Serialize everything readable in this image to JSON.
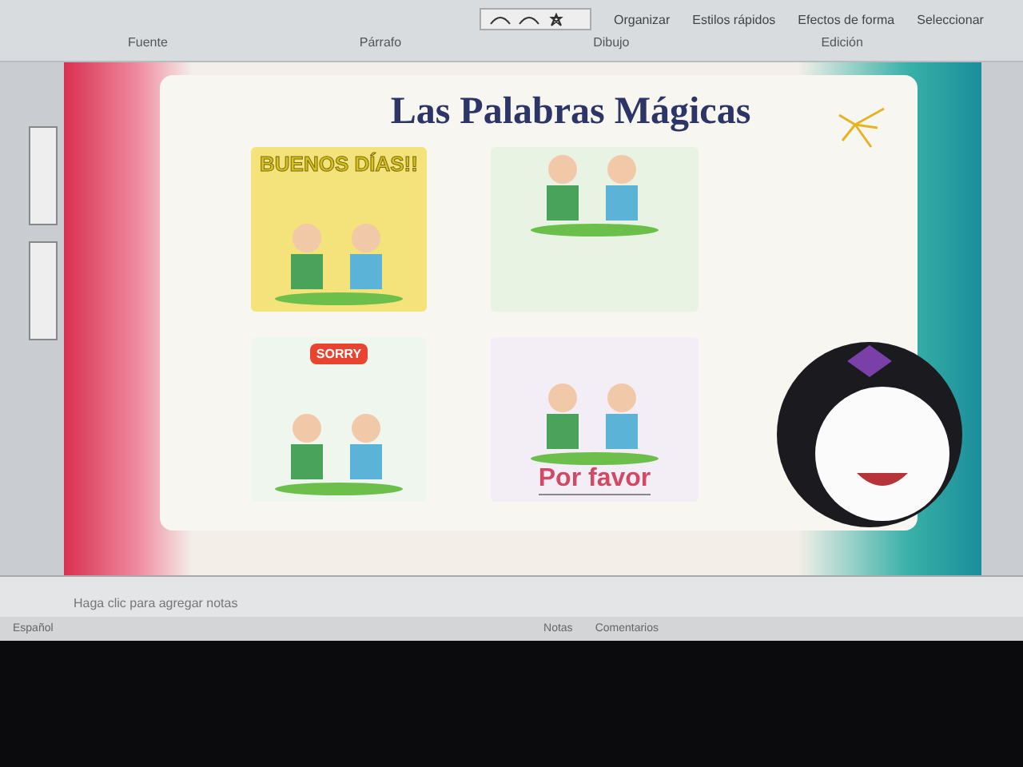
{
  "ribbon": {
    "groups": [
      {
        "label": "Fuente"
      },
      {
        "label": "Párrafo"
      },
      {
        "label": "Dibujo"
      },
      {
        "label": "Edición"
      }
    ],
    "commands": [
      {
        "label": "Organizar"
      },
      {
        "label": "Estilos rápidos"
      },
      {
        "label": "Efectos de forma"
      },
      {
        "label": "Seleccionar"
      }
    ]
  },
  "slide": {
    "title": "Las Palabras Mágicas",
    "pictures": [
      {
        "kind": "greeting",
        "caption": "BUENOS DÍAS!!"
      },
      {
        "kind": "sharing"
      },
      {
        "kind": "apology",
        "caption": "SORRY"
      },
      {
        "kind": "please",
        "caption": "Por favor"
      }
    ]
  },
  "notes": {
    "placeholder": "Haga clic para agregar notas"
  },
  "status_bar": {
    "language": "Español",
    "buttons": [
      {
        "label": "Notas"
      },
      {
        "label": "Comentarios"
      }
    ]
  }
}
